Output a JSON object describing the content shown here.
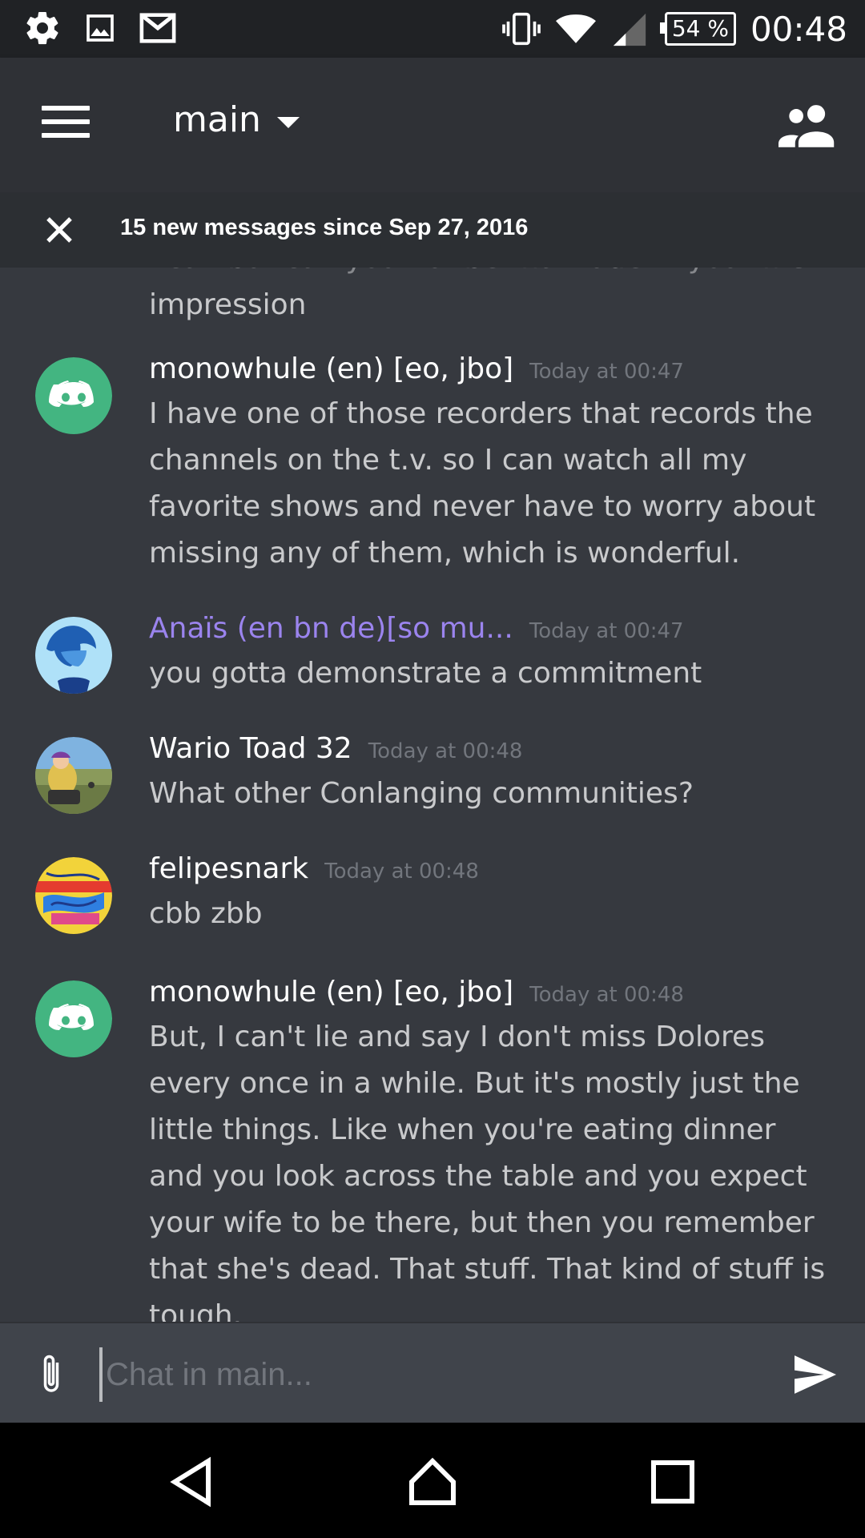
{
  "status_bar": {
    "battery": "54 %",
    "time": "00:48",
    "icons": [
      "gear-icon",
      "image-icon",
      "gmail-icon",
      "vibrate-icon",
      "wifi-icon",
      "signal-icon",
      "battery-icon"
    ]
  },
  "header": {
    "channel": "main",
    "icons": [
      "hamburger-menu-icon",
      "dropdown-caret-icon",
      "members-icon"
    ]
  },
  "new_messages_bar": {
    "text": "15 new messages since Sep 27, 2016"
  },
  "messages": [
    {
      "author": "",
      "timestamp": "",
      "partial_top_line": "I can but can you not be that rude in your first",
      "text": "impression"
    },
    {
      "author": "monowhule (en) [eo, jbo]",
      "timestamp": "Today at 00:47",
      "text": "I have one of those recorders that records the channels on the t.v. so I can watch all my favorite shows and never have to worry about missing any of them, which is wonderful.",
      "name_color": "#ffffff"
    },
    {
      "author": "Anaïs (en bn de)[so mu...",
      "timestamp": "Today at 00:47",
      "text": "you gotta demonstrate a commitment",
      "name_color": "#9b84ee"
    },
    {
      "author": "Wario Toad 32",
      "timestamp": "Today at 00:48",
      "text": "What other Conlanging communities?",
      "name_color": "#ffffff"
    },
    {
      "author": "felipesnark",
      "timestamp": "Today at 00:48",
      "text": "cbb zbb",
      "name_color": "#ffffff"
    },
    {
      "author": "monowhule (en) [eo, jbo]",
      "timestamp": "Today at 00:48",
      "text": "But, I can't lie and say I don't miss Dolores every once in a while. But it's mostly just the little things. Like when you're eating dinner and you look across the table and you expect your wife to be there, but then you remember that she's dead. That stuff. That kind of stuff is tough.",
      "name_color": "#ffffff"
    }
  ],
  "composer": {
    "placeholder": "Chat in main...",
    "value": "",
    "icons": [
      "paperclip-icon",
      "send-icon"
    ]
  },
  "nav_bar": {
    "icons": [
      "back-icon",
      "home-icon",
      "recents-icon"
    ]
  },
  "colors": {
    "background": "#36393f",
    "header": "#2f3136",
    "discord_green": "#43b581",
    "muted": "#72767d"
  }
}
